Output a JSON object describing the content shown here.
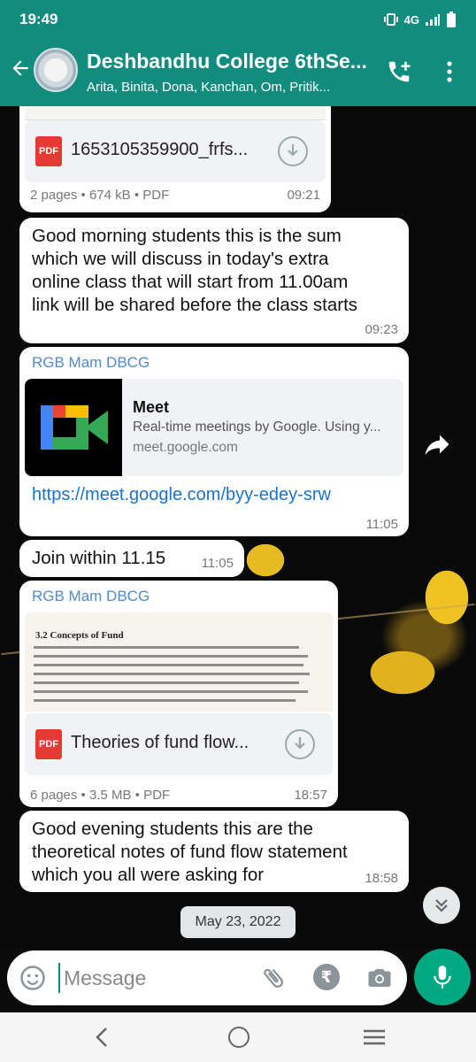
{
  "status": {
    "time": "19:49",
    "network": "4G"
  },
  "header": {
    "title": "Deshbandhu College 6thSe...",
    "subtitle": "Arita, Binita, Dona, Kanchan, Om, Pritik..."
  },
  "messages": {
    "doc1": {
      "file_name": "1653105359900_frfs...",
      "info": "2 pages • 674 kB • PDF",
      "time": "09:21",
      "pdf_label": "PDF"
    },
    "text1": {
      "lines": [
        "Good morning students this is the sum",
        "which we will discuss in today's extra",
        "online class that will start from 11.00am",
        "link will be shared before the class starts"
      ],
      "time": "09:23"
    },
    "link": {
      "sender": "RGB Mam DBCG",
      "title": "Meet",
      "description": "Real-time meetings by Google. Using y...",
      "domain": "meet.google.com",
      "url": "https://meet.google.com/byy-edey-srw",
      "time": "11:05"
    },
    "text2": {
      "text": "Join within 11.15",
      "time": "11:05"
    },
    "doc2": {
      "sender": "RGB Mam DBCG",
      "file_name": "Theories of fund flow...",
      "info": "6 pages • 3.5 MB • PDF",
      "time": "18:57",
      "pdf_label": "PDF",
      "preview_heading": "3.2 Concepts of Fund"
    },
    "text3": {
      "lines": [
        "Good evening students this are the",
        "theoretical notes of fund flow statement",
        "which you all were asking for"
      ],
      "time": "18:58"
    }
  },
  "date_chip": "May 23, 2022",
  "composer": {
    "placeholder": "Message",
    "rupee": "₹"
  },
  "icons": [
    "back-arrow-icon",
    "add-call-icon",
    "more-vert-icon",
    "pdf-icon",
    "download-icon",
    "share-icon",
    "scroll-down-icon",
    "emoji-icon",
    "attach-icon",
    "rupee-icon",
    "camera-icon",
    "mic-icon"
  ],
  "colors": {
    "header": "#128c7e",
    "accent": "#00a884",
    "link": "#1a73c8",
    "sender": "#4f8acb"
  }
}
